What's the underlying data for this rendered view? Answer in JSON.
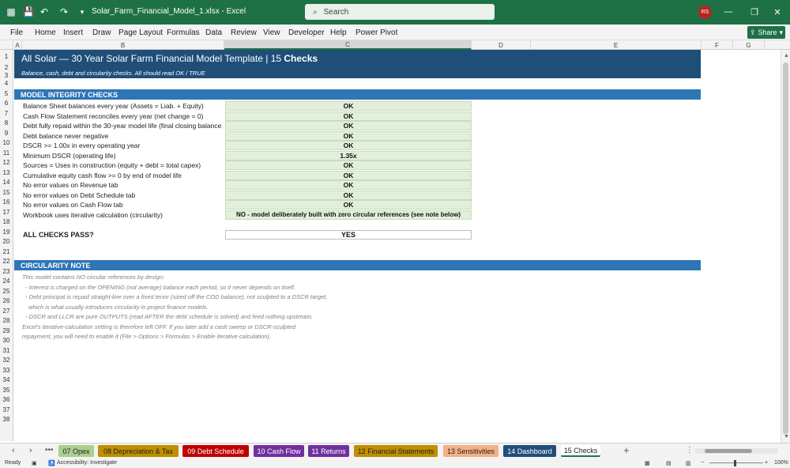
{
  "titlebar": {
    "filename": "Solar_Farm_Financial_Model_1.xlsx  -  Excel",
    "search_placeholder": "Search",
    "avatar": "RS",
    "undo": "↶",
    "redo": "↷"
  },
  "ribbon": {
    "tabs": [
      "File",
      "Home",
      "Insert",
      "Draw",
      "Page Layout",
      "Formulas",
      "Data",
      "Review",
      "View",
      "Developer",
      "Help",
      "Power Pivot"
    ],
    "share": "Share"
  },
  "columns": [
    "A",
    "B",
    "C",
    "D",
    "E",
    "F",
    "G"
  ],
  "rows": [
    "1",
    "2",
    "3",
    "4",
    "5",
    "6",
    "7",
    "8",
    "9",
    "10",
    "11",
    "12",
    "13",
    "14",
    "15",
    "16",
    "17",
    "18",
    "19",
    "20",
    "21",
    "22",
    "23",
    "24",
    "25",
    "26",
    "27",
    "28",
    "29",
    "30",
    "31",
    "32",
    "33",
    "34",
    "35",
    "36",
    "37",
    "38"
  ],
  "sheet": {
    "title_pre": "All Solar  —  30 Year Solar Farm Financial Model Template | 15 ",
    "title_bold": "Checks",
    "subtitle": "Balance, cash, debt and circularity checks. All should read OK / TRUE",
    "section1": "MODEL INTEGRITY CHECKS",
    "checks": [
      {
        "label": "Balance Sheet balances every year (Assets = Liab. + Equity)",
        "value": "OK"
      },
      {
        "label": "Cash Flow Statement reconciles every year (net change = 0)",
        "value": "OK"
      },
      {
        "label": "Debt fully repaid within the 30-year model life (final closing balance",
        "value": "OK"
      },
      {
        "label": "Debt balance never negative",
        "value": "OK"
      },
      {
        "label": "DSCR >= 1.00x in every operating year",
        "value": "OK"
      },
      {
        "label": "Minimum DSCR (operating life)",
        "value": "1.35x"
      },
      {
        "label": "Sources = Uses in construction (equity + debt = total capex)",
        "value": "OK"
      },
      {
        "label": "Cumulative equity cash flow >= 0 by end of model life",
        "value": "OK"
      },
      {
        "label": "No error values on Revenue tab",
        "value": "OK"
      },
      {
        "label": "No error values on Debt Schedule tab",
        "value": "OK"
      },
      {
        "label": "No error values on Cash Flow tab",
        "value": "OK"
      },
      {
        "label": "Workbook uses iterative calculation (circularity)",
        "value": "NO - model deliberately built with zero circular references (see note below)"
      }
    ],
    "all_pass_label": "ALL CHECKS PASS?",
    "all_pass_value": "YES",
    "section2": "CIRCULARITY NOTE",
    "notes": [
      "This model contains NO circular references by design:",
      "  - Interest is charged on the OPENING (not average) balance each period, so it never depends on itself.",
      "  - Debt principal is repaid straight-line over a fixed tenor (sized off the COD balance), not sculpted to a DSCR target,",
      "    which is what usually introduces circularity in project finance models.",
      "  - DSCR and LLCR are pure OUTPUTS (read AFTER the debt schedule is solved) and feed nothing upstream.",
      "Excel's iterative-calculation setting is therefore left OFF. If you later add a cash sweep or DSCR-sculpted",
      "repayment, you will need to enable it (File > Options > Formulas > Enable iterative calculation)."
    ]
  },
  "sheet_tabs": [
    {
      "label": "07 Opex",
      "color": "#a9d08e",
      "text": "#222"
    },
    {
      "label": "08 Depreciation & Tax",
      "color": "#bf8f00",
      "text": "#222"
    },
    {
      "label": "09 Debt Schedule",
      "color": "#c00000",
      "text": "#fff"
    },
    {
      "label": "10 Cash Flow",
      "color": "#7030a0",
      "text": "#fff"
    },
    {
      "label": "11 Returns",
      "color": "#7030a0",
      "text": "#fff"
    },
    {
      "label": "12 Financial Statements",
      "color": "#bf8f00",
      "text": "#222"
    },
    {
      "label": "13 Sensitivities",
      "color": "#f4b183",
      "text": "#222"
    },
    {
      "label": "14 Dashboard",
      "color": "#1f4e79",
      "text": "#fff"
    },
    {
      "label": "15 Checks",
      "color": "#ffffff",
      "text": "#222"
    }
  ],
  "status": {
    "ready": "Ready",
    "accessibility": "Accessibility: Investigate",
    "zoom": "100%"
  }
}
